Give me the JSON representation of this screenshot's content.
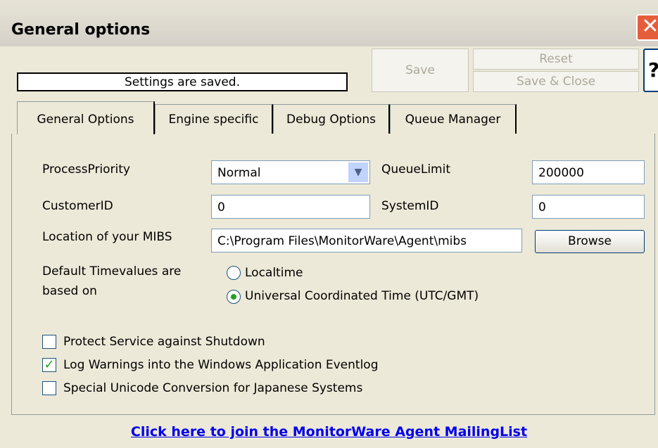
{
  "window": {
    "title": "General options"
  },
  "toolbar": {
    "status": "Settings are saved.",
    "save_label": "Save",
    "reset_label": "Reset",
    "save_close_label": "Save & Close",
    "help_label": "?"
  },
  "tabs": [
    {
      "label": "General Options",
      "active": true
    },
    {
      "label": "Engine specific",
      "active": false
    },
    {
      "label": "Debug Options",
      "active": false
    },
    {
      "label": "Queue Manager",
      "active": false
    }
  ],
  "form": {
    "process_priority_label": "ProcessPriority",
    "process_priority_value": "Normal",
    "queue_limit_label": "QueueLimit",
    "queue_limit_value": "200000",
    "customer_id_label": "CustomerID",
    "customer_id_value": "0",
    "system_id_label": "SystemID",
    "system_id_value": "0",
    "mibs_label": "Location of your MIBS",
    "mibs_value": "C:\\Program Files\\MonitorWare\\Agent\\mibs",
    "browse_label": "Browse",
    "timevalues_label_line1": "Default Timevalues are",
    "timevalues_label_line2": "based on",
    "radio_localtime": "Localtime",
    "radio_utc": "Universal Coordinated Time (UTC/GMT)",
    "check_protect": "Protect Service against Shutdown",
    "check_log_warnings": "Log Warnings into the Windows Application Eventlog",
    "check_unicode": "Special Unicode Conversion for Japanese Systems"
  },
  "footer": {
    "link": "Click here to join the MonitorWare Agent MailingList"
  }
}
